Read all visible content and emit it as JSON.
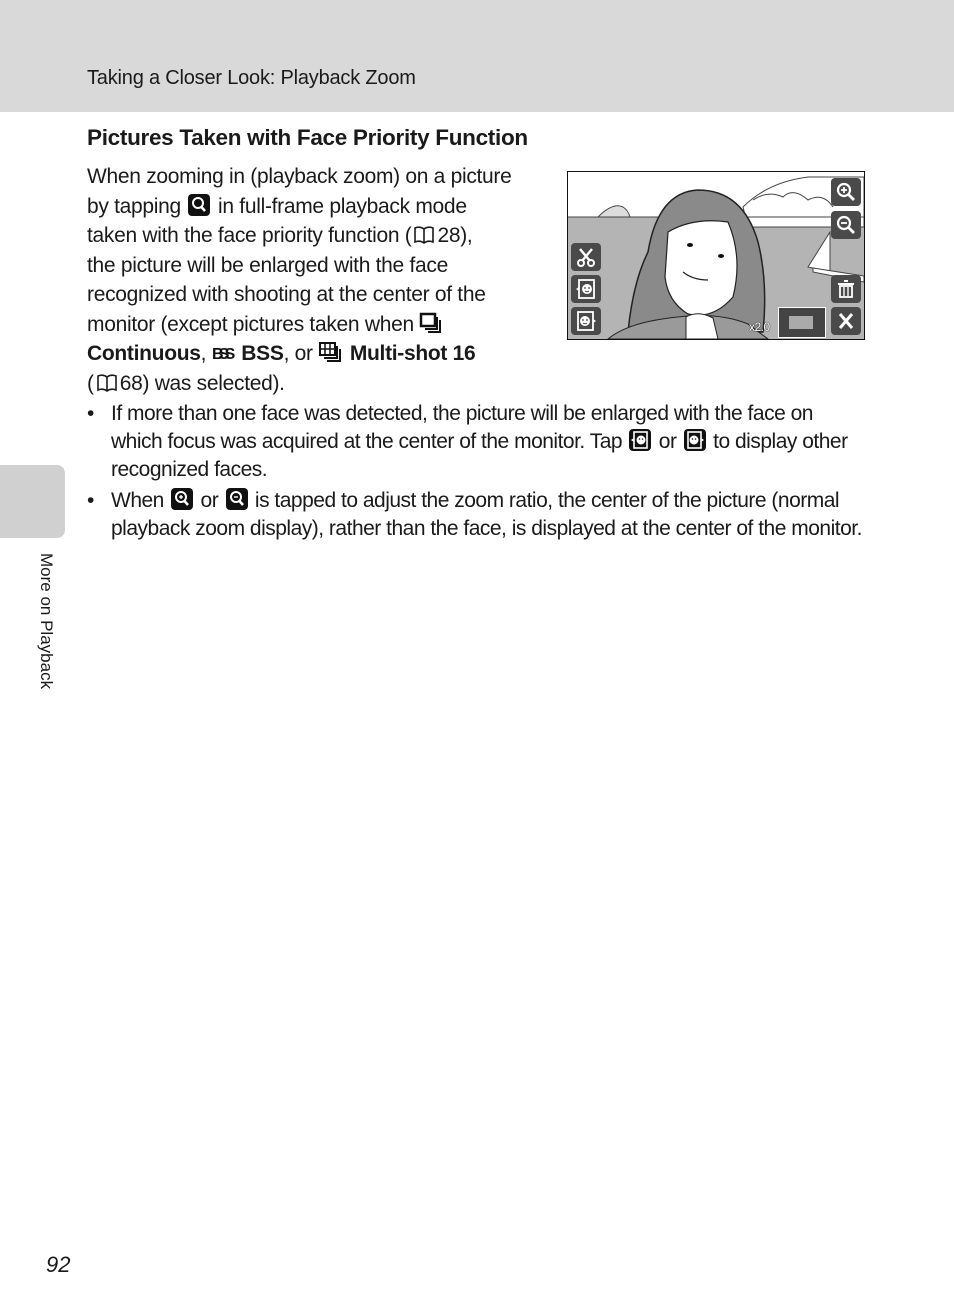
{
  "header": {
    "title": "Taking a Closer Look: Playback Zoom"
  },
  "section": {
    "title": "Pictures Taken with Face Priority Function"
  },
  "intro": {
    "l1": "When zooming in (playback zoom) on a picture",
    "l2a": "by tapping",
    "l2b": "in full-frame playback mode",
    "l3a": "taken with the face priority function (",
    "l3b": "28),",
    "l4": "the picture will be enlarged with the face",
    "l5": "recognized with shooting at the center of the",
    "l6": "monitor (except pictures taken when",
    "continuous": "Continuous",
    "comma1": ",",
    "bss": "BSS",
    "or": ", or",
    "multishot": "Multi-shot 16",
    "l8a": "(",
    "l8b": "68) was selected)."
  },
  "bullets": {
    "b1a": "If more than one face was detected, the picture will be enlarged with the face on which focus was acquired at the center of the monitor. Tap",
    "b1b": "or",
    "b1c": "to display other recognized faces.",
    "b2a": "When",
    "b2b": "or",
    "b2c": "is tapped to adjust the zoom ratio, the center of the picture (normal playback zoom display), rather than the face, is displayed at the center of the monitor.",
    "dot": "•"
  },
  "screen": {
    "zoom_ratio": "x2.0",
    "buttons": [
      "zoom-in-icon",
      "zoom-out-icon",
      "scissors-icon",
      "previous-face-icon",
      "next-face-icon",
      "trash-icon",
      "close-icon"
    ]
  },
  "sidebar": {
    "label": "More on Playback"
  },
  "footer": {
    "page_number": "92"
  }
}
